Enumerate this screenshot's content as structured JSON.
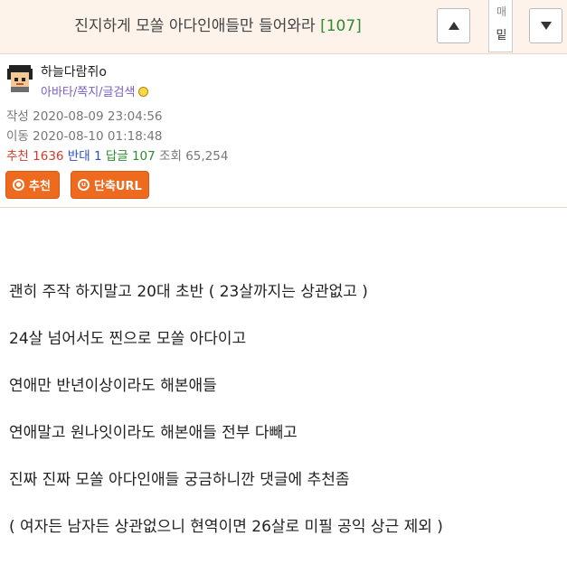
{
  "header": {
    "title": "진지하게 모쏠 아다인애들만 들어와라",
    "comment_count": "[107]",
    "prev_icon": "triangle-up-icon",
    "next_icon": "triangle-down-icon",
    "popup_top": "매",
    "popup_bottom": "밑"
  },
  "author": {
    "nickname": "하늘다람쥐o",
    "links": "아바타/쪽지/글검색",
    "avatar_icon": "pixel-avatar-icon"
  },
  "meta": {
    "written_label": "작성",
    "written": "2020-08-09 23:04:56",
    "modified_label": "이동",
    "modified": "2020-08-10 01:18:48",
    "recommend_label": "추천",
    "recommend": "1636",
    "oppose_label": "반대",
    "oppose": "1",
    "reply_label": "답글",
    "reply": "107",
    "views_label": "조회",
    "views": "65,254"
  },
  "buttons": {
    "recommend": "추천",
    "short_url": "단축URL"
  },
  "content": {
    "lines": [
      "괜히 주작 하지말고 20대 초반 ( 23살까지는 상관없고 )",
      "24살 넘어서도 찐으로 모쏠 아다이고",
      "연애만 반년이상이라도 해본애들",
      "연애말고 원나잇이라도 해본애들 전부 다빼고",
      "진짜 진짜 모쏠 아다인애들 궁금하니깐 댓글에 추천좀",
      "( 여자든 남자든 상관없으니 현역이면 26살로 미필 공익 상근 제외 )"
    ]
  },
  "colors": {
    "header_bg": "#fdf3ea",
    "button_orange": "#ee6a1f",
    "recommend_red": "#d23a2a",
    "oppose_blue": "#2b4fc0",
    "reply_green": "#2e8b2e"
  }
}
